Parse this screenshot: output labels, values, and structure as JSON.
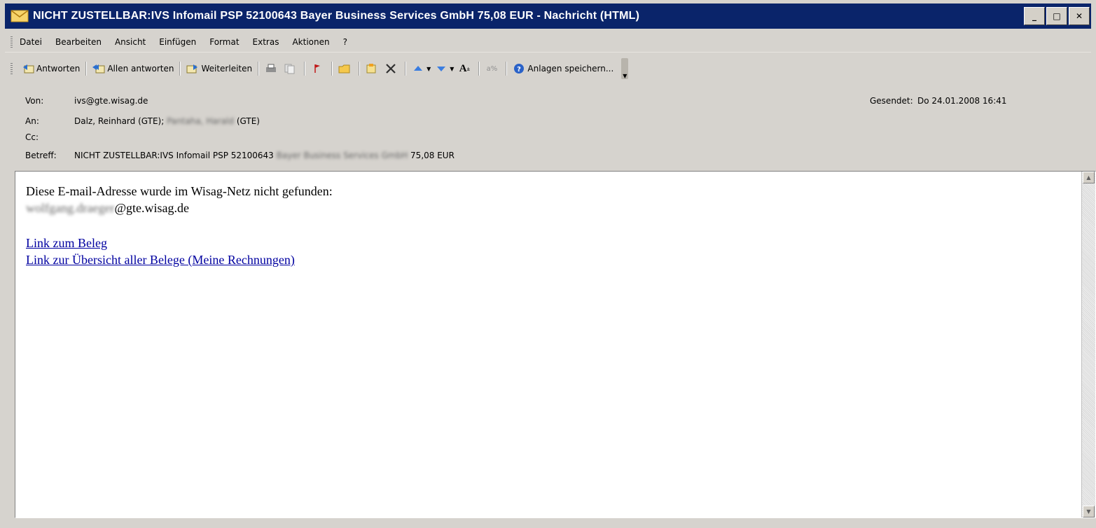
{
  "window": {
    "title": "NICHT ZUSTELLBAR:IVS Infomail PSP 52100643 Bayer Business Services GmbH 75,08 EUR - Nachricht (HTML)",
    "minimize": "_",
    "maximize": "□",
    "close": "✕"
  },
  "menu": {
    "items": [
      "Datei",
      "Bearbeiten",
      "Ansicht",
      "Einfügen",
      "Format",
      "Extras",
      "Aktionen",
      "?"
    ]
  },
  "toolbar": {
    "reply": "Antworten",
    "reply_all": "Allen antworten",
    "forward": "Weiterleiten",
    "save_attachments": "Anlagen speichern..."
  },
  "header": {
    "from_label": "Von:",
    "from_value": "ivs@gte.wisag.de",
    "to_label": "An:",
    "to_value_visible": "Dalz, Reinhard (GTE); ",
    "to_value_blurred": "Pantaha, Harald",
    "to_value_suffix": " (GTE)",
    "cc_label": "Cc:",
    "cc_value": "",
    "subject_label": "Betreff:",
    "subject_value_prefix": "NICHT ZUSTELLBAR:IVS Infomail PSP 52100643 ",
    "subject_value_blurred": "Bayer Business Services GmbH",
    "subject_value_suffix": " 75,08 EUR",
    "sent_label": "Gesendet:",
    "sent_value": "Do 24.01.2008 16:41"
  },
  "body": {
    "line1": "Diese E-mail-Adresse wurde im Wisag-Netz nicht gefunden:",
    "email_blurred": "wolfgang.draeger",
    "email_suffix": "@gte.wisag.de",
    "link1": "Link zum Beleg",
    "link2": "Link zur Übersicht aller Belege (Meine Rechnungen)"
  },
  "colors": {
    "titlebar": "#0a246a",
    "chrome": "#d6d3ce",
    "link": "#0000a0"
  }
}
